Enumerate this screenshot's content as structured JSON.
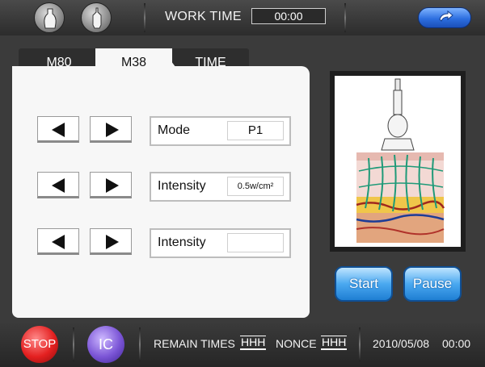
{
  "header": {
    "work_time_label": "WORK TIME",
    "work_time_value": "00:00",
    "probe_buttons": [
      "probe-1-icon",
      "probe-2-icon"
    ],
    "back_icon": "back-arrow-icon"
  },
  "tabs": [
    {
      "label": "M80",
      "active": false
    },
    {
      "label": "M38",
      "active": true
    },
    {
      "label": "TIME",
      "active": false
    }
  ],
  "settings": [
    {
      "label": "Mode",
      "value": "P1"
    },
    {
      "label": "Intensity",
      "value": "0.5w/cm²"
    },
    {
      "label": "Intensity",
      "value": ""
    }
  ],
  "image": {
    "icon": "ultrasound-skin-illustration"
  },
  "actions": {
    "start": "Start",
    "pause": "Pause"
  },
  "footer": {
    "stop": "STOP",
    "ic": "IC",
    "remain_label": "REMAIN TIMES",
    "remain_value": "HHH",
    "nonce_label": "NONCE",
    "nonce_value": "HHH",
    "date": "2010/05/08",
    "time": "00:00"
  },
  "colors": {
    "background": "#3b3b3b",
    "panel": "#f7f7f7",
    "accent_blue": "#2d6fe0",
    "stop_red": "#e42020",
    "ic_purple": "#7b55d6"
  }
}
